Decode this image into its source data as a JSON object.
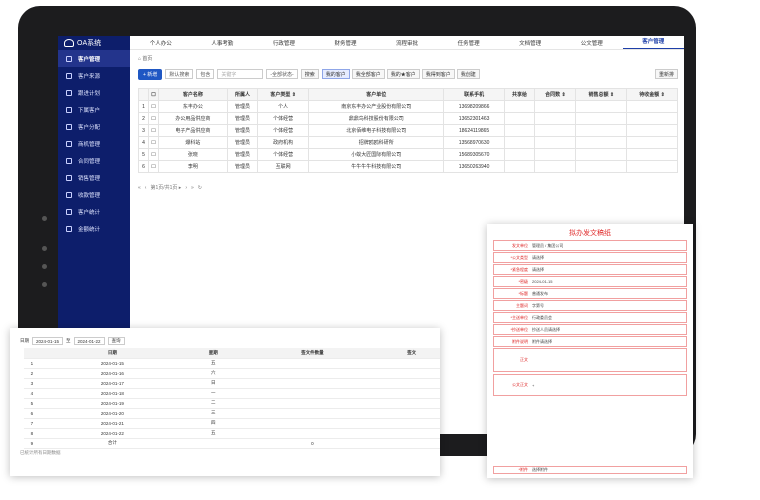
{
  "app": {
    "logo_text": "OA系统"
  },
  "top_nav": [
    "个人办公",
    "人事考勤",
    "行政管理",
    "财务管理",
    "流程审批",
    "任务管理",
    "文档管理",
    "公文管理",
    "客户管理"
  ],
  "top_nav_active": 8,
  "sidebar": {
    "items": [
      "客户管理",
      "客户来源",
      "跟进计划",
      "下属客户",
      "客户分配",
      "商机管理",
      "合同管理",
      "销售管理",
      "收款管理",
      "客户统计",
      "金额统计"
    ],
    "active": 0
  },
  "breadcrumb": "首页",
  "toolbar": {
    "new_label": "+ 新增",
    "search_type": "默认搜索",
    "select1": "包含",
    "keyword_placeholder": "关键字",
    "status": "-全部状态-",
    "search_btn": "搜索",
    "tabs": [
      "我的客户",
      "我全部客户",
      "我的★客户",
      "我得到客户",
      "我创建"
    ],
    "active_tab": 0,
    "refresh": "重新排"
  },
  "table": {
    "headers": [
      "",
      "",
      "客户名称",
      "所属人",
      "客户类型 ⇕",
      "客户单位",
      "联系手机",
      "共享给",
      "合同数 ⇕",
      "销售总额 ⇕",
      "待收金额 ⇕"
    ],
    "rows": [
      [
        "1",
        "",
        "东丰办公",
        "管理员",
        "个人",
        "南京东丰办公产业股份有限公司",
        "13698209866",
        "",
        "",
        "",
        ""
      ],
      [
        "2",
        "",
        "办公用品供应商",
        "管理员",
        "个体经营",
        "鼎鼎鸟科技股份有限公司",
        "13652301463",
        "",
        "",
        "",
        ""
      ],
      [
        "3",
        "",
        "电子产品供应商",
        "管理员",
        "个体经营",
        "北京佰维电子科技有限公司",
        "18624119865",
        "",
        "",
        "",
        ""
      ],
      [
        "4",
        "",
        "爆科站",
        "管理员",
        "政府机构",
        "招牌鸥鸥科研所",
        "13568970630",
        "",
        "",
        "",
        ""
      ],
      [
        "5",
        "",
        "张晓",
        "管理员",
        "个体经营",
        "小蚁大匠国际有限公司",
        "15689305670",
        "",
        "",
        "",
        ""
      ],
      [
        "6",
        "",
        "李明",
        "管理员",
        "互联网",
        "牛牛牛牛科技有限公司",
        "13650263940",
        "",
        "",
        "",
        ""
      ]
    ]
  },
  "pager": {
    "text": "第1页/共1页 ▸"
  },
  "attendance": {
    "filter_label": "日期",
    "date_from": "2024-01-15",
    "date_to": "2024-01-22",
    "query_btn": "查询",
    "headers": [
      "",
      "日期",
      "星期",
      "签文件数量",
      "签文"
    ],
    "rows": [
      [
        "1",
        "2024-01-15",
        "五",
        "",
        ""
      ],
      [
        "2",
        "2024-01-16",
        "六",
        "",
        ""
      ],
      [
        "3",
        "2024-01-17",
        "日",
        "",
        ""
      ],
      [
        "4",
        "2024-01-18",
        "一",
        "",
        ""
      ],
      [
        "5",
        "2024-01-19",
        "二",
        "",
        ""
      ],
      [
        "6",
        "2024-01-20",
        "三",
        "",
        ""
      ],
      [
        "7",
        "2024-01-21",
        "四",
        "",
        ""
      ],
      [
        "8",
        "2024-01-22",
        "五",
        "",
        ""
      ],
      [
        "9",
        "合计",
        "",
        "0",
        ""
      ]
    ],
    "footer": "已统计所有日期数据"
  },
  "form": {
    "title": "拟办发文稿纸",
    "field_values": {
      "creator": "管理员",
      "unit": "集团公司",
      "date": "2024-01-15",
      "level": "请选择",
      "secret": "请选择",
      "type": "普通发布",
      "word": "字第号",
      "to": "行政委员会",
      "copy": "抄送人员请选择",
      "attach": "附件请选择",
      "add_label": "+"
    },
    "labels": [
      "发文单位",
      "*公文类型",
      "*紧急程度",
      "*密级",
      "*标题",
      "主题词",
      "*主送单位",
      "*抄送单位",
      "附件说明",
      "正文",
      "公文正文",
      "*附件"
    ],
    "bottom_btn": "选择附件"
  }
}
